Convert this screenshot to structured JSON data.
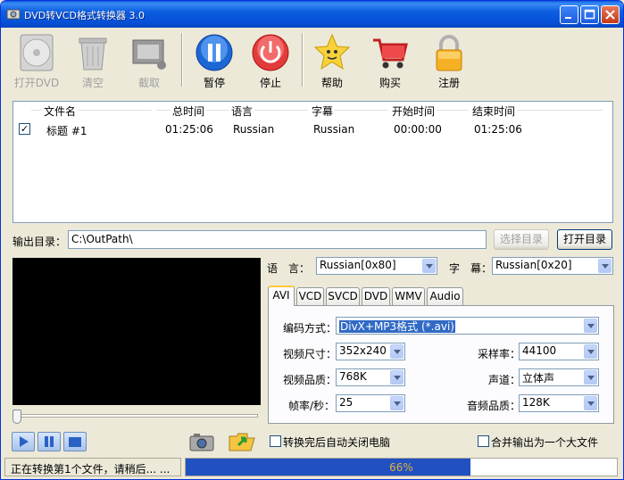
{
  "window": {
    "title": "DVD转VCD格式转换器 3.0"
  },
  "toolbar": {
    "open_dvd": "打开DVD",
    "clear": "清空",
    "capture": "截取",
    "pause": "暂停",
    "stop": "停止",
    "help": "帮助",
    "buy": "购买",
    "register": "注册"
  },
  "list": {
    "columns": [
      "文件名",
      "总时间",
      "语言",
      "字幕",
      "开始时间",
      "结束时间"
    ],
    "rows": [
      {
        "checked": true,
        "name": "标题 #1",
        "total": "01:25:06",
        "language": "Russian",
        "subtitle": "Russian",
        "start": "00:00:00",
        "end": "01:25:06"
      }
    ]
  },
  "output": {
    "label": "输出目录：",
    "path": "C:\\OutPath\\",
    "choose_button": "选择目录",
    "open_button": "打开目录"
  },
  "audio": {
    "language_label": "语　言：",
    "language_value": "Russian[0x80]",
    "subtitle_label": "字　幕：",
    "subtitle_value": "Russian[0x20]"
  },
  "tabs": [
    "AVI",
    "VCD",
    "SVCD",
    "DVD",
    "WMV",
    "Audio"
  ],
  "active_tab": "AVI",
  "settings": {
    "encoding_label": "编码方式：",
    "encoding_value": "DivX+MP3格式 (*.avi)",
    "size_label": "视频尺寸：",
    "size_value": "352x240",
    "quality_label": "视频品质：",
    "quality_value": "768K",
    "fps_label": "帧率/秒：",
    "fps_value": "25",
    "samplerate_label": "采样率：",
    "samplerate_value": "44100",
    "channel_label": "声道：",
    "channel_value": "立体声",
    "audioq_label": "音频品质：",
    "audioq_value": "128K"
  },
  "options": {
    "auto_shutdown": "转换完后自动关闭电脑",
    "merge_output": "合并输出为一个大文件"
  },
  "status": {
    "message": "正在转换第1个文件，请稍后... ...",
    "progress": 0.66,
    "progress_text": "66%"
  }
}
